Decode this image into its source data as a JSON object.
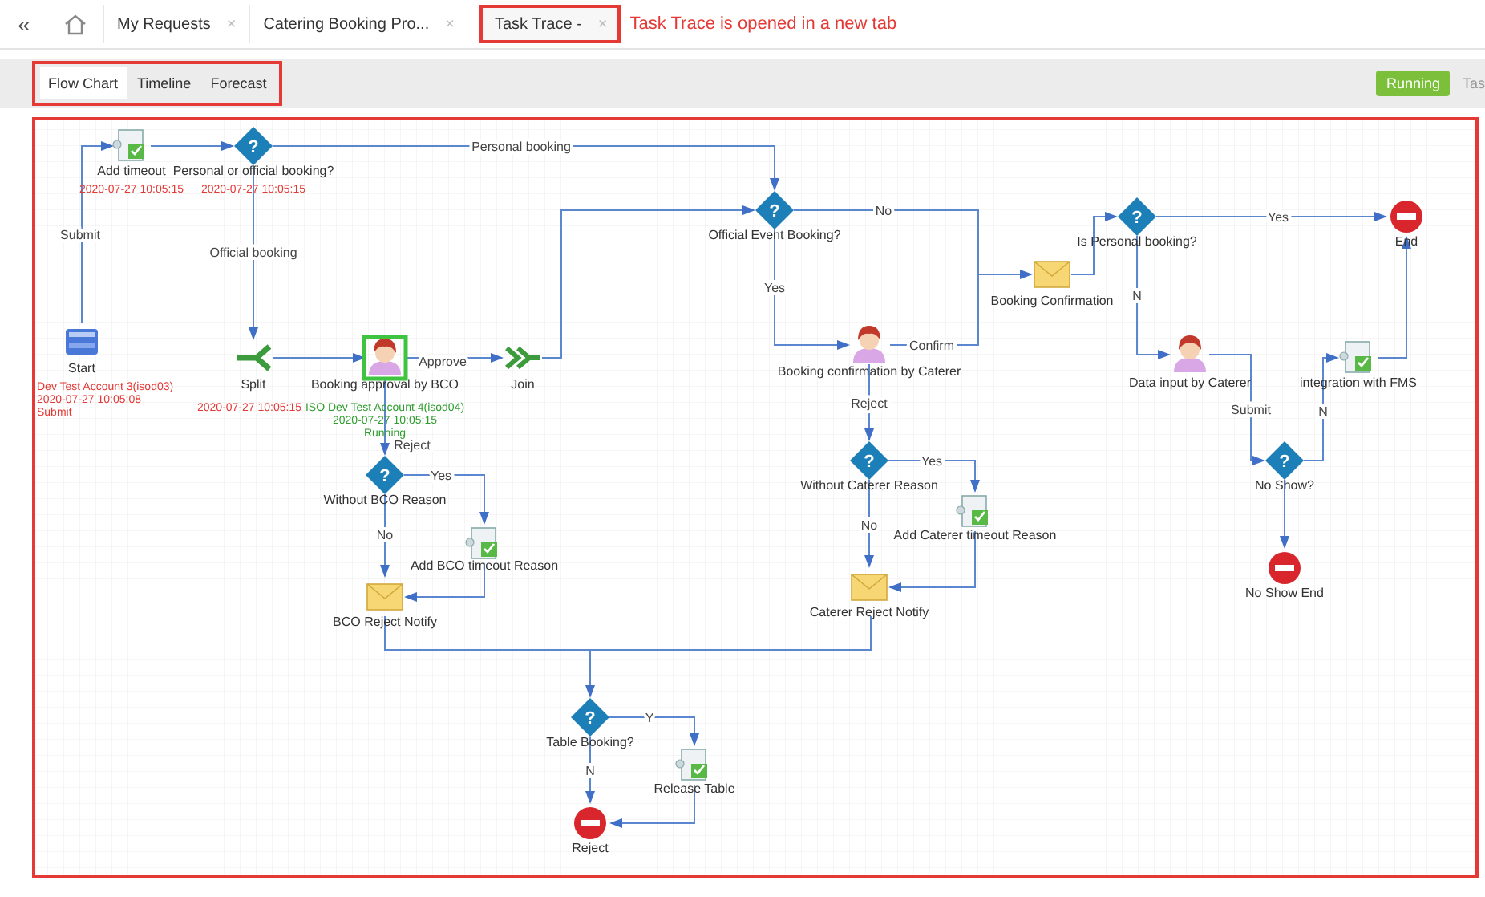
{
  "tabs": [
    {
      "label": "My Requests",
      "selected": false
    },
    {
      "label": "Catering Booking Pro...",
      "selected": false
    },
    {
      "label": "Task Trace -",
      "selected": true
    }
  ],
  "tab_close": "×",
  "back_glyph": "«",
  "annotation": "Task Trace is opened in a new tab",
  "view_tabs": [
    {
      "label": "Flow Chart",
      "selected": true
    },
    {
      "label": "Timeline",
      "selected": false
    },
    {
      "label": "Forecast",
      "selected": false
    }
  ],
  "status_badge": "Running",
  "status_label": "Tas",
  "flow": {
    "nodes": [
      {
        "kind": "task",
        "label": "Add timeout",
        "current": false,
        "trace": {
          "color": "#e53935",
          "lines": [
            "2020-07-27 10:05:15"
          ]
        }
      },
      {
        "kind": "decision",
        "symbol": "?",
        "label": "Personal or official booking?",
        "current": false,
        "trace": {
          "color": "#e53935",
          "lines": [
            "2020-07-27 10:05:15"
          ]
        }
      },
      {
        "kind": "start",
        "label": "Start",
        "current": false,
        "trace": {
          "color": "#e53935",
          "lines": [
            "Dev Test Account 3(isod03)",
            "2020-07-27 10:05:08",
            "Submit"
          ]
        }
      },
      {
        "kind": "split",
        "label": "Split",
        "current": false,
        "trace": {
          "color": "#e53935",
          "lines": [
            "2020-07-27 10:05:15"
          ]
        }
      },
      {
        "kind": "user",
        "label": "Booking approval by BCO",
        "current": true,
        "trace": {
          "color": "#2f9e2f",
          "lines": [
            "ISO Dev Test Account 4(isod04)",
            "2020-07-27 10:05:15",
            "Running"
          ]
        }
      },
      {
        "kind": "join",
        "label": "Join",
        "current": false
      },
      {
        "kind": "decision",
        "symbol": "?",
        "label": "Official Event Booking?",
        "current": false
      },
      {
        "kind": "user",
        "label": "Booking confirmation by Caterer",
        "current": false
      },
      {
        "kind": "mail",
        "label": "Booking Confirmation",
        "current": false
      },
      {
        "kind": "decision",
        "symbol": "?",
        "label": "Is Personal booking?",
        "current": false
      },
      {
        "kind": "end",
        "label": "End",
        "current": false
      },
      {
        "kind": "user",
        "label": "Data input by Caterer",
        "current": false
      },
      {
        "kind": "task",
        "label": "integration with FMS",
        "current": false
      },
      {
        "kind": "decision",
        "symbol": "?",
        "label": "No Show?",
        "current": false
      },
      {
        "kind": "end",
        "label": "No Show End",
        "current": false
      },
      {
        "kind": "decision",
        "symbol": "?",
        "label": "Without BCO Reason",
        "current": false
      },
      {
        "kind": "task",
        "label": "Add BCO timeout Reason",
        "current": false
      },
      {
        "kind": "mail",
        "label": "BCO Reject Notify",
        "current": false
      },
      {
        "kind": "decision",
        "symbol": "?",
        "label": "Without Caterer Reason",
        "current": false
      },
      {
        "kind": "task",
        "label": "Add Caterer timeout Reason",
        "current": false
      },
      {
        "kind": "mail",
        "label": "Caterer Reject Notify",
        "current": false
      },
      {
        "kind": "decision",
        "symbol": "?",
        "label": "Table Booking?",
        "current": false
      },
      {
        "kind": "task",
        "label": "Release Table",
        "current": false
      },
      {
        "kind": "end",
        "label": "Reject",
        "current": false
      }
    ],
    "edge_labels": [
      "Submit",
      "Personal booking",
      "Official booking",
      "Approve",
      "Yes",
      "No",
      "Confirm",
      "Yes",
      "N",
      "Submit",
      "N",
      "Reject",
      "Yes",
      "No",
      "Reject",
      "Yes",
      "No",
      "Y",
      "N"
    ]
  }
}
